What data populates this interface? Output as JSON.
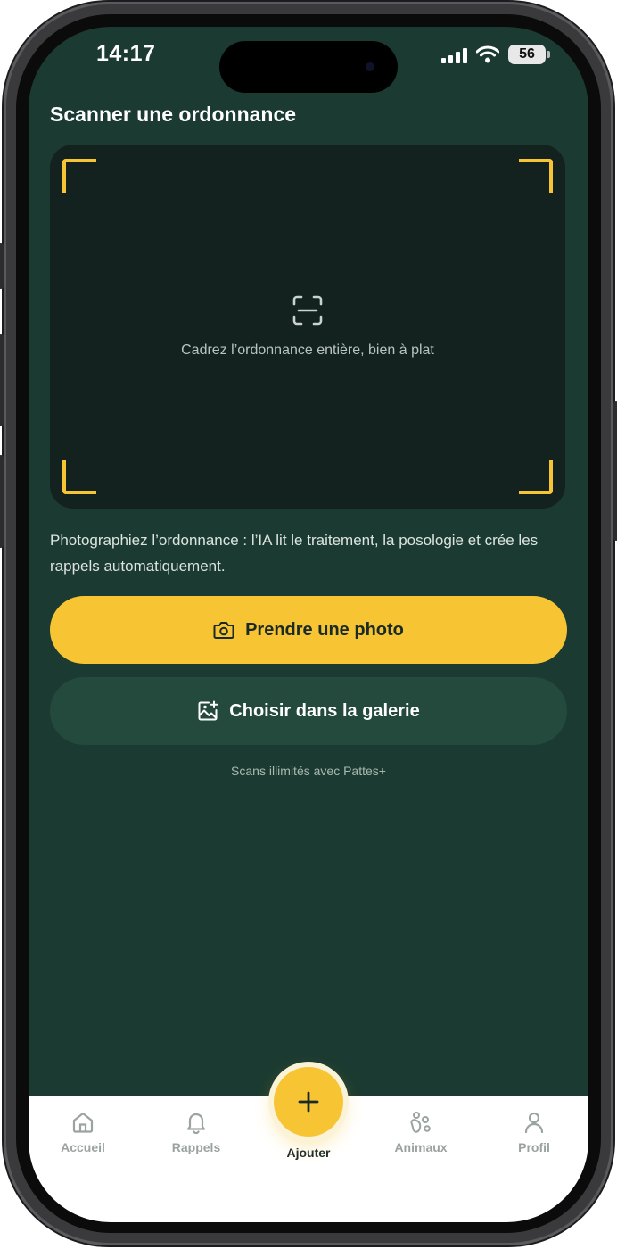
{
  "status_bar": {
    "time": "14:17",
    "battery": "56",
    "icons": [
      "signal-icon",
      "wifi-icon",
      "battery-icon"
    ]
  },
  "screen": {
    "title": "Scanner une ordonnance",
    "scan_hint": "Cadrez l’ordonnance entière, bien à plat",
    "description": "Photographiez l’ordonnance : l’IA lit le traitement, la posologie et crée les rappels automatiquement.",
    "take_photo_label": "Prendre une photo",
    "gallery_label": "Choisir dans la galerie",
    "upsell": "Scans illimités avec Pattes+"
  },
  "tab_bar": {
    "items": [
      {
        "label": "Accueil",
        "icon": "home-icon"
      },
      {
        "label": "Rappels",
        "icon": "bell-icon"
      },
      {
        "label": "Ajouter",
        "icon": "plus-icon",
        "active": true
      },
      {
        "label": "Animaux",
        "icon": "paw-icon"
      },
      {
        "label": "Profil",
        "icon": "user-icon"
      }
    ]
  },
  "colors": {
    "background": "#1b3a31",
    "accent": "#f7c434",
    "secondary_button": "#234a3d",
    "scan_area": "#13221e",
    "tab_inactive": "#9aa3a0"
  }
}
